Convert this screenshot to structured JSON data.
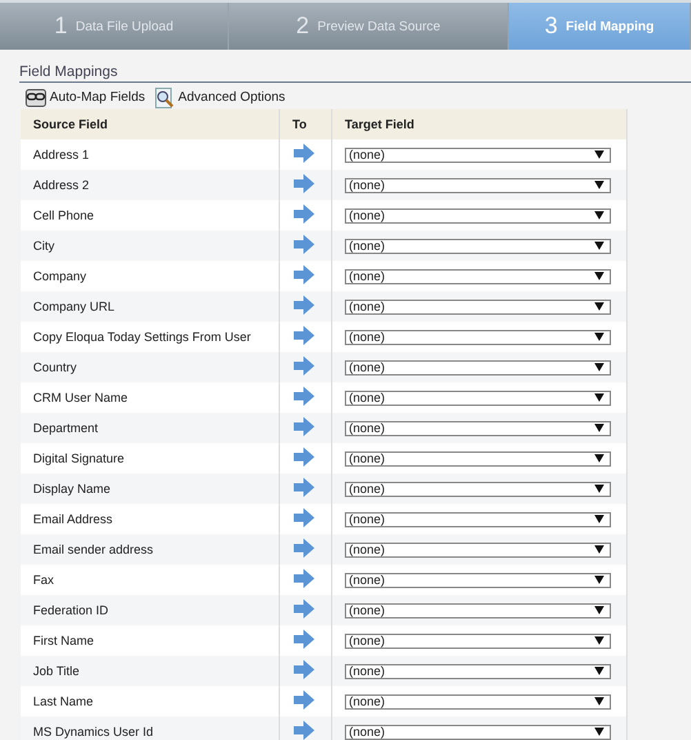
{
  "steps": [
    {
      "number": "1",
      "label": "Data File Upload",
      "selected": false
    },
    {
      "number": "2",
      "label": "Preview Data Source",
      "selected": false
    },
    {
      "number": "3",
      "label": "Field Mapping",
      "selected": true
    }
  ],
  "section_title": "Field Mappings",
  "toolbar": [
    {
      "kind": "automap",
      "label": "Auto-Map Fields"
    },
    {
      "kind": "advanced",
      "label": "Advanced Options"
    }
  ],
  "table": {
    "columns": [
      "Source Field",
      "To",
      "Target Field"
    ],
    "rows": [
      {
        "source": "Address 1",
        "target": "(none)"
      },
      {
        "source": "Address 2",
        "target": "(none)"
      },
      {
        "source": "Cell Phone",
        "target": "(none)"
      },
      {
        "source": "City",
        "target": "(none)"
      },
      {
        "source": "Company",
        "target": "(none)"
      },
      {
        "source": "Company URL",
        "target": "(none)"
      },
      {
        "source": "Copy Eloqua Today Settings From User",
        "target": "(none)"
      },
      {
        "source": "Country",
        "target": "(none)"
      },
      {
        "source": "CRM User Name",
        "target": "(none)"
      },
      {
        "source": "Department",
        "target": "(none)"
      },
      {
        "source": "Digital Signature",
        "target": "(none)"
      },
      {
        "source": "Display Name",
        "target": "(none)"
      },
      {
        "source": "Email Address",
        "target": "(none)"
      },
      {
        "source": "Email sender address",
        "target": "(none)"
      },
      {
        "source": "Fax",
        "target": "(none)"
      },
      {
        "source": "Federation ID",
        "target": "(none)"
      },
      {
        "source": "First Name",
        "target": "(none)"
      },
      {
        "source": "Job Title",
        "target": "(none)"
      },
      {
        "source": "Last Name",
        "target": "(none)"
      },
      {
        "source": "MS Dynamics User Id",
        "target": "(none)"
      }
    ]
  }
}
